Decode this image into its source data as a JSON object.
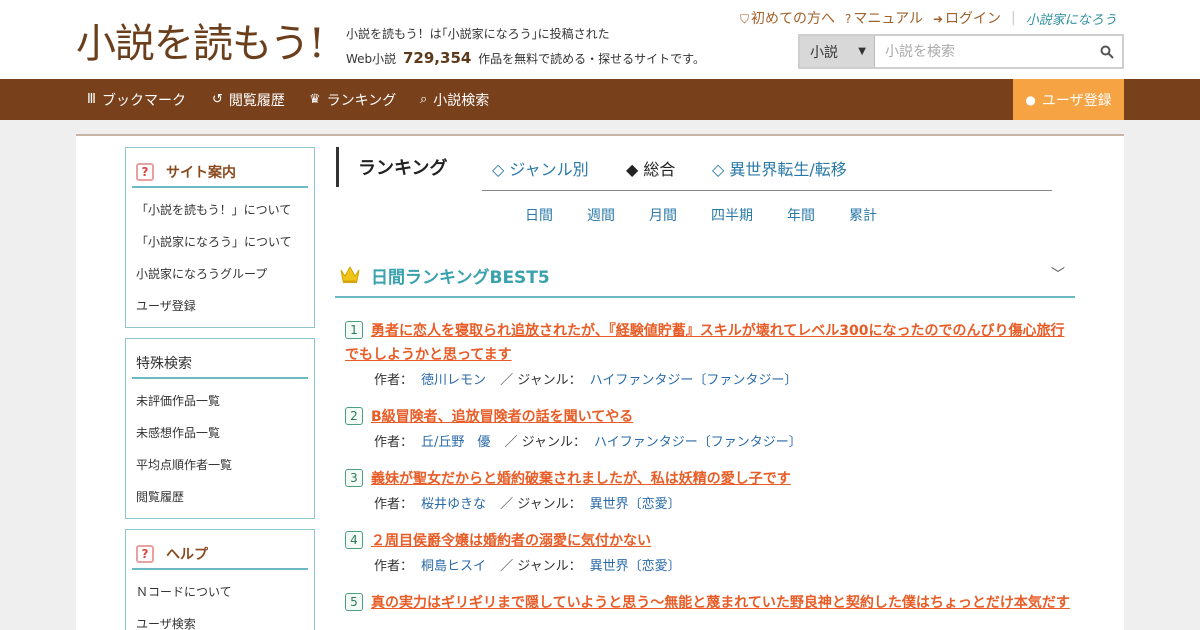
{
  "header": {
    "logo_text": "小説を読もう!",
    "tagline_line1": "小説を読もう！は｢小説家になろう｣に投稿された",
    "tagline_prefix": "Web小説",
    "work_count": "729,354",
    "tagline_suffix": "作品を無料で読める・探せるサイトです。",
    "links": [
      {
        "icon": "shield-icon",
        "glyph": "⛉",
        "label": "初めての方へ"
      },
      {
        "icon": "question-circle-icon",
        "glyph": "?",
        "label": "マニュアル"
      },
      {
        "icon": "login-icon",
        "glyph": "➜",
        "label": "ログイン"
      }
    ],
    "brand_mini": "小説家になろう",
    "search": {
      "category": "小説",
      "placeholder": "小説を検索"
    }
  },
  "nav": {
    "items": [
      {
        "icon": "bookmark-icon",
        "glyph": "Ⅲ",
        "label": "ブックマーク"
      },
      {
        "icon": "history-icon",
        "glyph": "↺",
        "label": "閲覧履歴"
      },
      {
        "icon": "crown-icon",
        "glyph": "♛",
        "label": "ランキング"
      },
      {
        "icon": "search-icon",
        "glyph": "⌕",
        "label": "小説検索"
      }
    ],
    "register": "ユーザ登録"
  },
  "sidebar": {
    "site_guide": {
      "title": "サイト案内",
      "links": [
        "「小説を読もう！」について",
        "「小説家になろう」について",
        "小説家になろうグループ",
        "ユーザ登録"
      ]
    },
    "special_search": {
      "title": "特殊検索",
      "links": [
        "未評価作品一覧",
        "未感想作品一覧",
        "平均点順作者一覧",
        "閲覧履歴"
      ]
    },
    "help": {
      "title": "ヘルプ",
      "links": [
        "Ｎコードについて",
        "ユーザ検索"
      ]
    }
  },
  "ranking": {
    "title": "ランキング",
    "tabs": [
      "◇ ジャンル別",
      "◆ 総合",
      "◇ 異世界転生/転移"
    ],
    "periods": [
      "日間",
      "週間",
      "月間",
      "四半期",
      "年間",
      "累計"
    ],
    "best_title": "日間ランキングBEST5",
    "author_label": "作者：",
    "genre_label": "／ ジャンル：",
    "items": [
      {
        "rank": "1",
        "title": "勇者に恋人を寝取られ追放されたが、『経験値貯蓄』スキルが壊れてレベル300になったのでのんびり傷心旅行でもしようかと思ってます",
        "author": "徳川レモン",
        "genre": "ハイファンタジー〔ファンタジー〕"
      },
      {
        "rank": "2",
        "title": "B級冒険者、追放冒険者の話を聞いてやる",
        "author": "丘/丘野　優",
        "genre": "ハイファンタジー〔ファンタジー〕"
      },
      {
        "rank": "3",
        "title": "義妹が聖女だからと婚約破棄されましたが、私は妖精の愛し子です",
        "author": "桜井ゆきな",
        "genre": "異世界〔恋愛〕"
      },
      {
        "rank": "4",
        "title": "２周目侯爵令嬢は婚約者の溺愛に気付かない",
        "author": "桐島ヒスイ",
        "genre": "異世界〔恋愛〕"
      },
      {
        "rank": "5",
        "title": "真の実力はギリギリまで隠していようと思う～無能と蔑まれていた野良神と契約した僕はちょっとだけ本気だす",
        "author": "",
        "genre": ""
      }
    ]
  },
  "colors": {
    "nav_bg": "#78401b",
    "register_bg": "#f6a344",
    "accent_teal": "#3aa2ad",
    "title_orange": "#e85d27",
    "link_blue": "#2a6aa8"
  }
}
